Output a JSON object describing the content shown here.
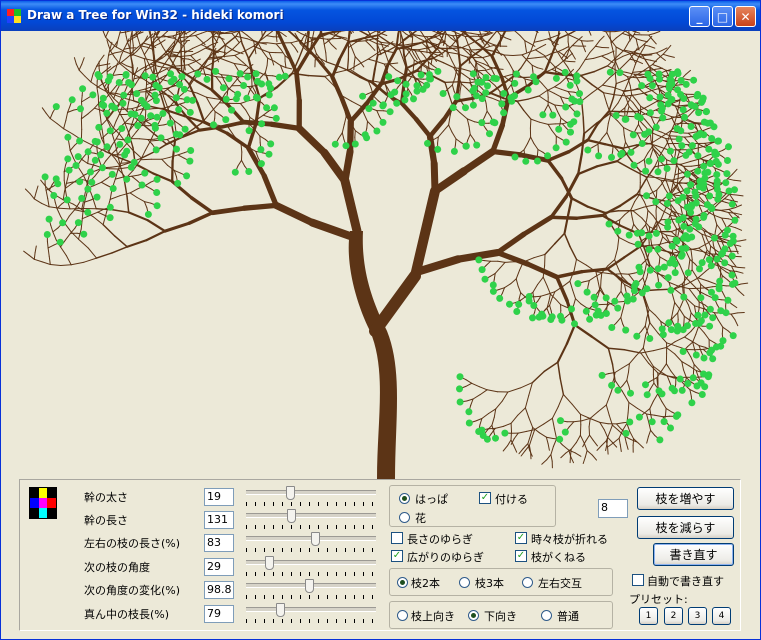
{
  "window": {
    "title": "Draw a Tree for Win32 - hideki komori",
    "minimize_label": "_",
    "maximize_label": "□",
    "close_label": "✕"
  },
  "colors": {
    "trunk": "#5c3416",
    "leaf": "#2fd24a",
    "background": "#ece9d8",
    "titlebar": "#0a54e3"
  },
  "params": [
    {
      "label": "幹の太さ",
      "value": "19",
      "level": 0.33
    },
    {
      "label": "幹の長さ",
      "value": "131",
      "level": 0.34
    },
    {
      "label": "左右の枝の長さ(%)",
      "value": "83",
      "level": 0.54
    },
    {
      "label": "次の枝の角度",
      "value": "29",
      "level": 0.16
    },
    {
      "label": "次の角度の変化(%)",
      "value": "98.8",
      "level": 0.49
    },
    {
      "label": "真ん中の枝長(%)",
      "value": "79",
      "level": 0.25
    }
  ],
  "leaf_group": {
    "radio_leaf": "はっぱ",
    "radio_flower": "花",
    "attach_label": "付ける",
    "attach_checked": true
  },
  "options": {
    "length_fluct": "長さのゆらぎ",
    "spread_fluct": "広がりのゆらぎ",
    "sometimes_break": "時々枝が折れる",
    "branch_wave": "枝がくねる"
  },
  "branch_group": {
    "two": "枝2本",
    "three": "枝3本",
    "alternate": "左右交互"
  },
  "direction_group": {
    "up": "枝上向き",
    "down": "下向き",
    "normal": "普通"
  },
  "level_value": "8",
  "buttons": {
    "increase": "枝を増やす",
    "decrease": "枝を減らす",
    "redraw": "書き直す",
    "auto_redraw": "自動で書き直す",
    "presets_label": "プリセット:",
    "presets": [
      "1",
      "2",
      "3",
      "4"
    ]
  }
}
